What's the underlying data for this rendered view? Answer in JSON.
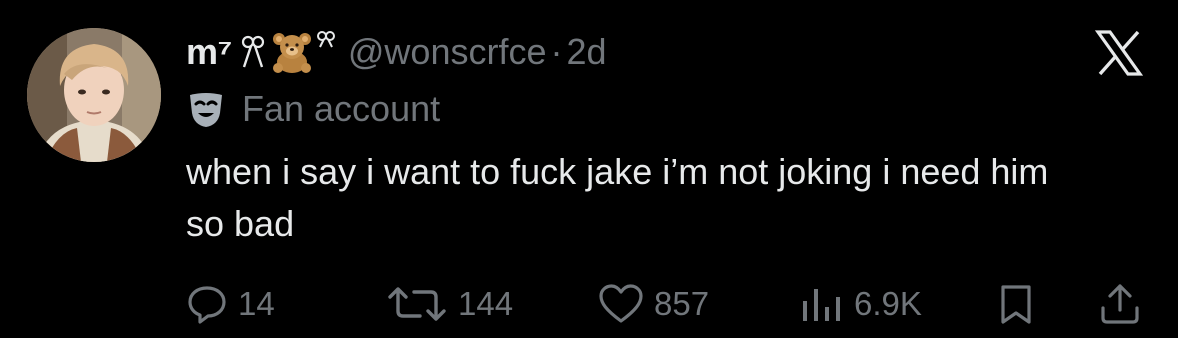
{
  "tweet": {
    "display_name": "m⁷",
    "name_emojis": [
      "ribbon-icon",
      "teddy-bear-icon",
      "ribbon-icon"
    ],
    "handle": "@wonscrfce",
    "separator": "·",
    "time": "2d",
    "label_icon": "theater-mask-icon",
    "label": "Fan account",
    "text": "when i say i want to fuck jake i’m not joking i need him so bad",
    "platform_icon": "x-logo-icon"
  },
  "actions": {
    "replies": "14",
    "reposts": "144",
    "likes": "857",
    "views": "6.9K"
  },
  "colors": {
    "background": "#000000",
    "primary_text": "#e7e9ea",
    "secondary_text": "#71767b"
  }
}
